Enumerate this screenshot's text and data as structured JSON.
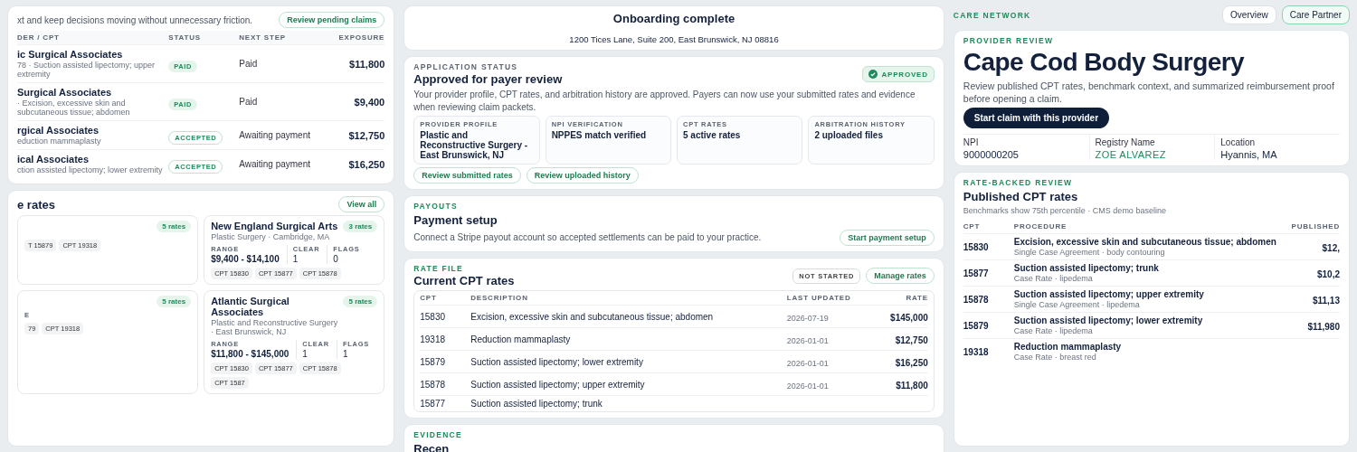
{
  "claims_panel": {
    "intro": "xt and keep decisions moving without unnecessary friction.",
    "action": "Review pending claims",
    "columns": [
      "DER / CPT",
      "STATUS",
      "NEXT STEP",
      "EXPOSURE"
    ],
    "rows": [
      {
        "provider": "ic Surgical Associates",
        "procedure": "78 · Suction assisted lipectomy; upper extremity",
        "status": "PAID",
        "kind": "paid",
        "next_step": "Paid",
        "exposure": "$11,800"
      },
      {
        "provider": "Surgical Associates",
        "procedure": "· Excision, excessive skin and subcutaneous tissue; abdomen",
        "status": "PAID",
        "kind": "paid",
        "next_step": "Paid",
        "exposure": "$9,400"
      },
      {
        "provider": "rgical Associates",
        "procedure": "eduction mammaplasty",
        "status": "ACCEPTED",
        "kind": "accepted",
        "next_step": "Awaiting payment",
        "exposure": "$12,750"
      },
      {
        "provider": "ical Associates",
        "procedure": "ction assisted lipectomy; lower extremity",
        "status": "ACCEPTED",
        "kind": "accepted",
        "next_step": "Awaiting payment",
        "exposure": "$16,250"
      }
    ]
  },
  "rates_panel": {
    "title": "e rates",
    "action": "View all",
    "cards": [
      {
        "count": "5 rates",
        "chips": [
          "T 15879",
          "CPT 19318"
        ]
      },
      {
        "name": "New England Surgical Arts",
        "subtitle": "Plastic Surgery · Cambridge, MA",
        "count": "3 rates",
        "range_label": "RANGE",
        "range": "$9,400 - $14,100",
        "clear_label": "CLEAR",
        "clear": "1",
        "flags_label": "FLAGS",
        "flags": "0",
        "chips": [
          "CPT 15830",
          "CPT 15877",
          "CPT 15878"
        ]
      },
      {
        "range_label": "E",
        "count": "5 rates",
        "chips": [
          "79",
          "CPT 19318"
        ]
      },
      {
        "name": "Atlantic Surgical Associates",
        "subtitle": "Plastic and Reconstructive Surgery · East Brunswick, NJ",
        "count": "5 rates",
        "range_label": "RANGE",
        "range": "$11,800 - $145,000",
        "clear_label": "CLEAR",
        "clear": "1",
        "flags_label": "FLAGS",
        "flags": "1",
        "chips": [
          "CPT 15830",
          "CPT 15877",
          "CPT 15878",
          "CPT 1587"
        ]
      }
    ]
  },
  "onboarding": {
    "title": "Onboarding complete",
    "address": "1200 Tices Lane, Suite 200, East Brunswick, NJ 08816"
  },
  "application": {
    "eyebrow": "APPLICATION STATUS",
    "title": "Approved for payer review",
    "description": "Your provider profile, CPT rates, and arbitration history are approved. Payers can now use your submitted rates and evidence when reviewing claim packets.",
    "badge": "APPROVED",
    "tiles": [
      {
        "label": "PROVIDER PROFILE",
        "value": "Plastic and Reconstructive Surgery - East Brunswick, NJ"
      },
      {
        "label": "NPI VERIFICATION",
        "value": "NPPES match verified"
      },
      {
        "label": "CPT RATES",
        "value": "5 active rates"
      },
      {
        "label": "ARBITRATION HISTORY",
        "value": "2 uploaded files"
      }
    ],
    "actions": [
      "Review submitted rates",
      "Review uploaded history"
    ]
  },
  "payouts": {
    "eyebrow": "PAYOUTS",
    "title": "Payment setup",
    "description": "Connect a Stripe payout account so accepted settlements can be paid to your practice.",
    "action": "Start payment setup"
  },
  "rate_file": {
    "eyebrow": "RATE FILE",
    "title": "Current CPT rates",
    "badge": "NOT STARTED",
    "action": "Manage rates",
    "columns": [
      "CPT",
      "DESCRIPTION",
      "LAST UPDATED",
      "RATE"
    ],
    "rows": [
      {
        "cpt": "15830",
        "description": "Excision, excessive skin and subcutaneous tissue; abdomen",
        "updated": "2026-07-19",
        "rate": "$145,000"
      },
      {
        "cpt": "19318",
        "description": "Reduction mammaplasty",
        "updated": "2026-01-01",
        "rate": "$12,750"
      },
      {
        "cpt": "15879",
        "description": "Suction assisted lipectomy; lower extremity",
        "updated": "2026-01-01",
        "rate": "$16,250"
      },
      {
        "cpt": "15878",
        "description": "Suction assisted lipectomy; upper extremity",
        "updated": "2026-01-01",
        "rate": "$11,800"
      },
      {
        "cpt": "15877",
        "description": "Suction assisted lipectomy; trunk"
      }
    ]
  },
  "evidence": {
    "eyebrow": "EVIDENCE",
    "title": "Recen"
  },
  "network": {
    "brand": "CARE NETWORK",
    "nav": [
      {
        "label": "Overview",
        "selected": false
      },
      {
        "label": "Care Partner",
        "selected": true
      }
    ]
  },
  "provider": {
    "eyebrow": "PROVIDER REVIEW",
    "title": "Cape Cod Body Surgery",
    "description": "Review published CPT rates, benchmark context, and summarized reimbursement proof before opening a claim.",
    "action": "Start claim with this provider",
    "facts": [
      {
        "label": "NPI",
        "value": "9000000205",
        "kind": "plain"
      },
      {
        "label": "Registry Name",
        "value": "ZOE ALVAREZ",
        "kind": "accent"
      },
      {
        "label": "Location",
        "value": "Hyannis, MA",
        "kind": "plain"
      }
    ]
  },
  "published": {
    "eyebrow": "RATE-BACKED REVIEW",
    "title": "Published CPT rates",
    "note": "Benchmarks show 75th percentile · CMS demo baseline",
    "columns": [
      "CPT",
      "PROCEDURE",
      "PUBLISHED"
    ],
    "rows": [
      {
        "cpt": "15830",
        "procedure": "Excision, excessive skin and subcutaneous tissue; abdomen",
        "detail": "Single Case Agreement · body contouring",
        "rate": "$12,"
      },
      {
        "cpt": "15877",
        "procedure": "Suction assisted lipectomy; trunk",
        "detail": "Case Rate · lipedema",
        "rate": "$10,2"
      },
      {
        "cpt": "15878",
        "procedure": "Suction assisted lipectomy; upper extremity",
        "detail": "Single Case Agreement · lipedema",
        "rate": "$11,13"
      },
      {
        "cpt": "15879",
        "procedure": "Suction assisted lipectomy; lower extremity",
        "detail": "Case Rate · lipedema",
        "rate": "$11,980"
      },
      {
        "cpt": "19318",
        "procedure": "Reduction mammaplasty",
        "detail": "Case Rate · breast red"
      }
    ]
  }
}
